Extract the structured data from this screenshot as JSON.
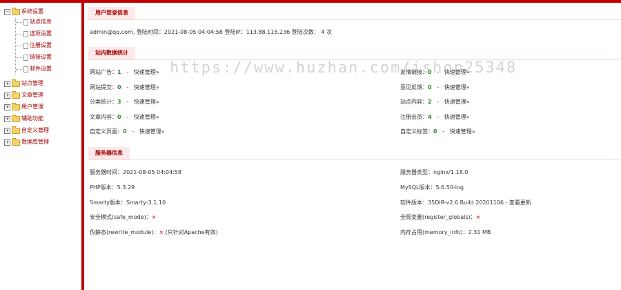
{
  "sidebar": {
    "root": {
      "label": "系统设置",
      "expander": "−"
    },
    "children": [
      "站点信息",
      "选项设置",
      "注册设置",
      "链接设置",
      "邮件设置"
    ],
    "groups": [
      {
        "label": "站点管理",
        "expander": "+"
      },
      {
        "label": "文章管理",
        "expander": "+"
      },
      {
        "label": "用户管理",
        "expander": "+"
      },
      {
        "label": "辅助功能",
        "expander": "+"
      },
      {
        "label": "自定义管理",
        "expander": "+"
      },
      {
        "label": "数据库管理",
        "expander": "+"
      }
    ]
  },
  "login": {
    "title": "用户登录信息",
    "line": "admin@qq.com,  登陆时间：2021-08-05 04:04:58    登陆IP：113.88.115.236    登陆次数：  4  次"
  },
  "stats": {
    "title": "站内数据统计",
    "sep": "-",
    "link": "快速管理»",
    "left": [
      {
        "label": "网站广告：",
        "value": "1"
      },
      {
        "label": "网站提交：",
        "value": "0"
      },
      {
        "label": "分类统计：",
        "value": "3"
      },
      {
        "label": "文章内容：",
        "value": "0"
      },
      {
        "label": "自定义页面：",
        "value": "0"
      }
    ],
    "right": [
      {
        "label": "友情链接：",
        "value": "0"
      },
      {
        "label": "意见反馈：",
        "value": "0"
      },
      {
        "label": "站点内容：",
        "value": "2"
      },
      {
        "label": "注册会员：",
        "value": "4"
      },
      {
        "label": "自定义标签：",
        "value": "0"
      }
    ]
  },
  "server": {
    "title": "服务器信息",
    "left": [
      {
        "label": "服务器时间：",
        "value": "2021-08-05    04:04:58",
        "cls": ""
      },
      {
        "label": "PHP版本：",
        "value": "5.3.29",
        "cls": ""
      },
      {
        "label": "Smarty版本：",
        "value": "Smarty-3.1.10",
        "cls": ""
      },
      {
        "label": "安全模式(safe_mode)：",
        "value": "×",
        "cls": "red"
      },
      {
        "label": "伪静态(rewrite_module)：",
        "value": "×",
        "cls": "red",
        "extra": "(只针对Apache有效)"
      }
    ],
    "right": [
      {
        "label": "服务器类型：",
        "value": "nginx/1.18.0",
        "cls": ""
      },
      {
        "label": "MySQL版本：",
        "value": "5.6.50-log",
        "cls": ""
      },
      {
        "label": "软件版本：",
        "value": "35DIR-v2.6 Build 20201106 - 查看更新",
        "cls": ""
      },
      {
        "label": "全局变量(register_globals)：",
        "value": "×",
        "cls": "red"
      },
      {
        "label": "内存占用(memory_info)：",
        "value": "2.31 MB",
        "cls": ""
      }
    ]
  },
  "watermark": "https://www.huzhan.com/ishop25348",
  "colors": {
    "accent": "#c00000",
    "count": "#2a8a2a",
    "cross": "#d00000",
    "title_bg": "#fde9e9"
  }
}
